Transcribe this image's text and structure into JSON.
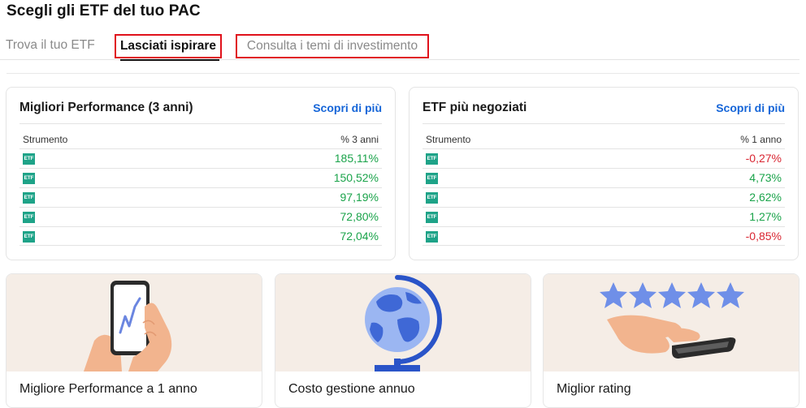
{
  "page": {
    "title": "Scegli gli ETF del tuo PAC"
  },
  "tabs": [
    {
      "label": "Trova il tuo ETF"
    },
    {
      "label": "Lasciati ispirare"
    },
    {
      "label": "Consulta i temi di investimento"
    }
  ],
  "cards": {
    "performance": {
      "title": "Migliori Performance (3 anni)",
      "link": "Scopri di più",
      "col_left": "Strumento",
      "col_right": "% 3 anni",
      "badge": "ETF",
      "rows": [
        "185,11%",
        "150,52%",
        "97,19%",
        "72,80%",
        "72,04%"
      ]
    },
    "traded": {
      "title": "ETF più negoziati",
      "link": "Scopri di più",
      "col_left": "Strumento",
      "col_right": "% 1 anno",
      "badge": "ETF",
      "rows": [
        "-0,27%",
        "4,73%",
        "2,62%",
        "1,27%",
        "-0,85%"
      ]
    }
  },
  "tiles": [
    {
      "label": "Migliore Performance a 1 anno"
    },
    {
      "label": "Costo gestione annuo"
    },
    {
      "label": "Miglior rating"
    }
  ],
  "colors": {
    "accent_link": "#1565d8",
    "positive": "#1aa34a",
    "negative": "#d92632",
    "highlight_box": "#e0111b",
    "etf_badge": "#1ea388"
  }
}
